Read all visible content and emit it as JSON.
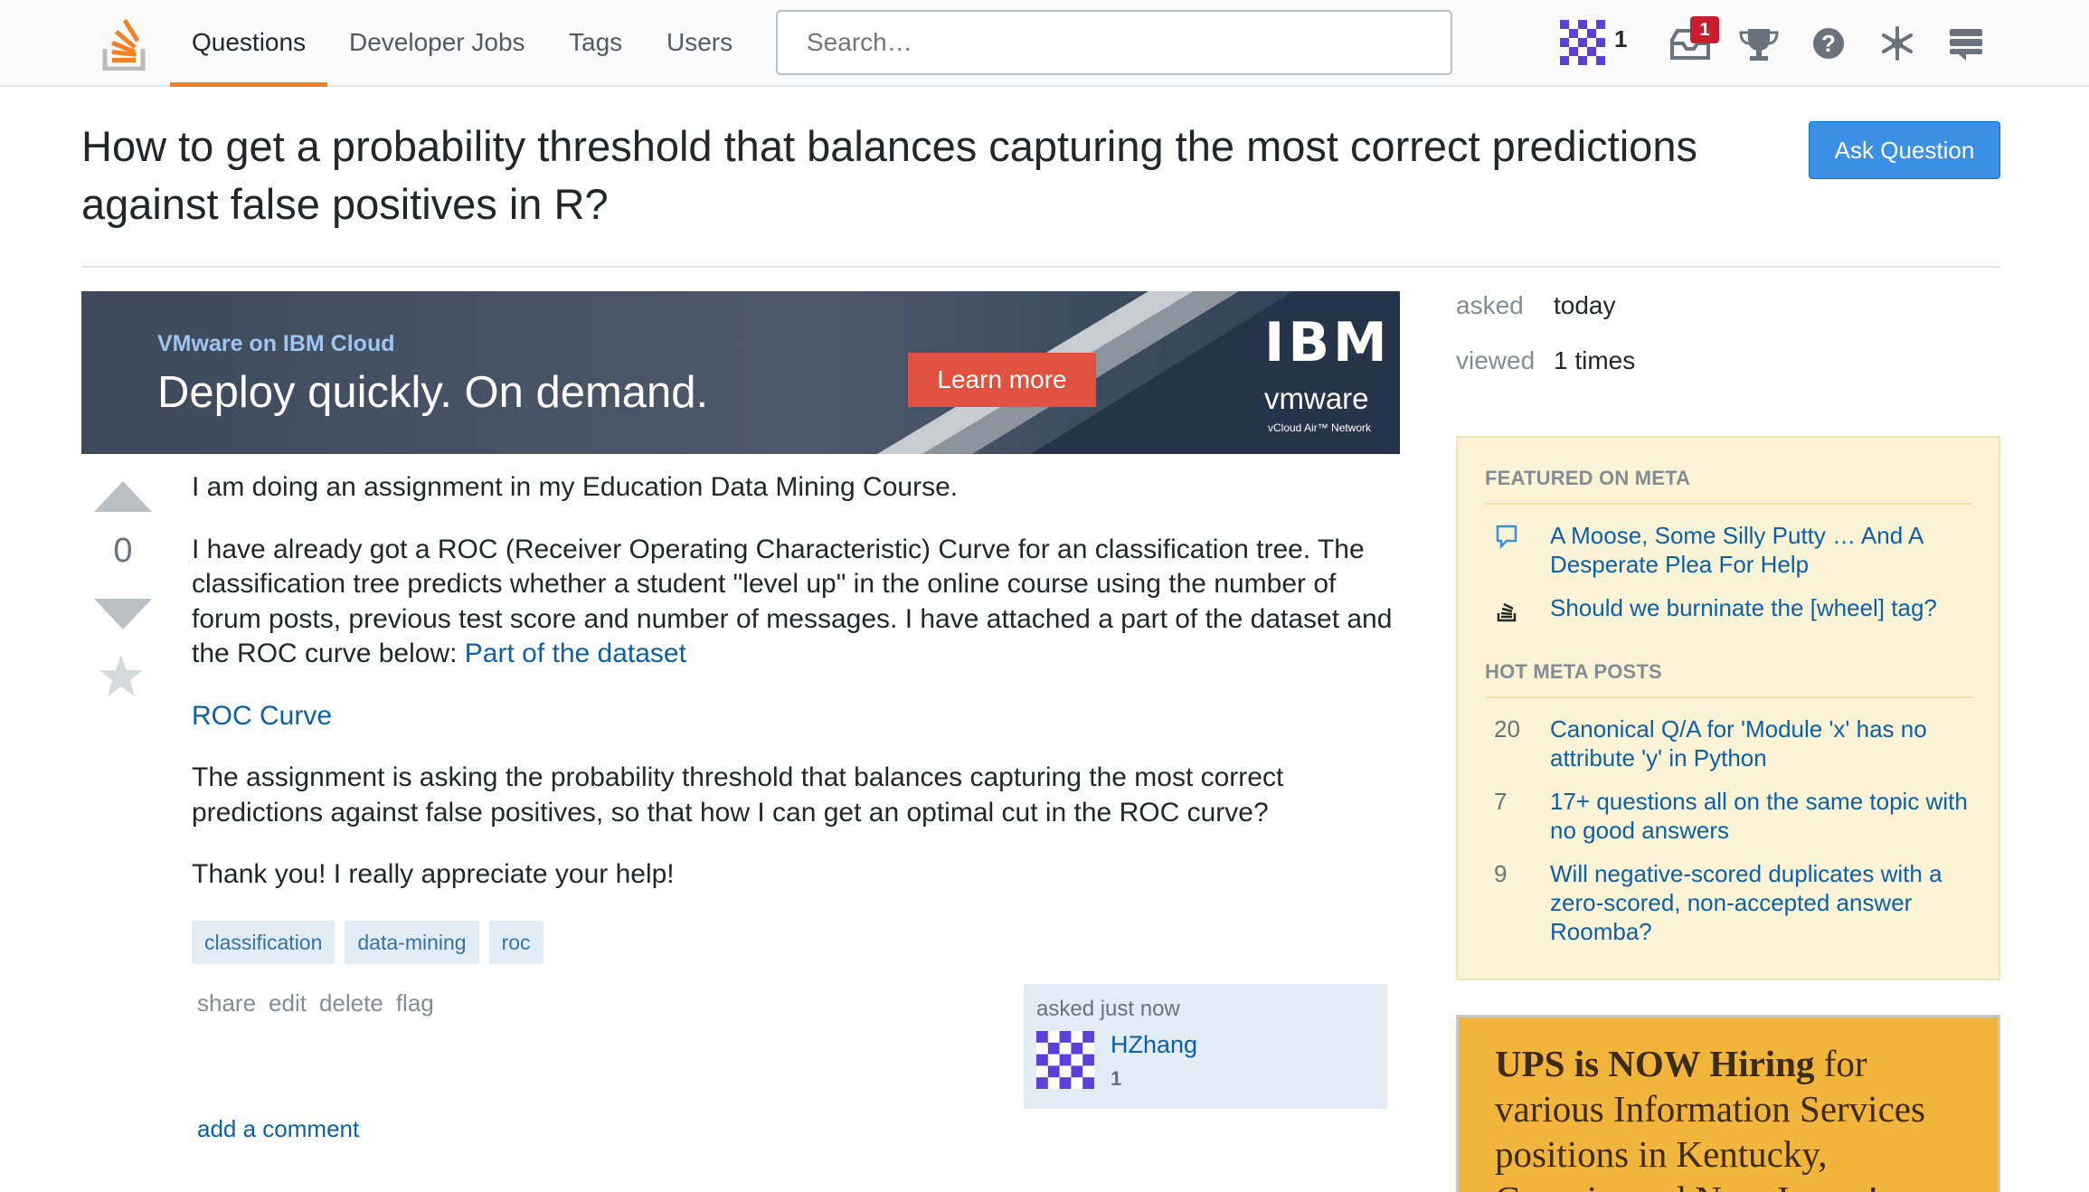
{
  "topbar": {
    "nav": [
      "Questions",
      "Developer Jobs",
      "Tags",
      "Users"
    ],
    "search_placeholder": "Search…",
    "reputation": "1",
    "inbox_count": "1"
  },
  "question": {
    "title": "How to get a probability threshold that balances capturing the most correct predictions against false positives in R?",
    "ask_button": "Ask Question",
    "votes": "0",
    "body": {
      "p1": "I am doing an assignment in my Education Data Mining Course.",
      "p2_text": "I have already got a ROC (Receiver Operating Characteristic) Curve for an classification tree. The classification tree predicts whether a student \"level up\" in the online course using the number of forum posts, previous test score and number of messages. I have attached a part of the dataset and the ROC curve below: ",
      "p2_link": "Part of the dataset",
      "roc_link": "ROC Curve",
      "p3": "The assignment is asking the probability threshold that balances capturing the most correct predictions against false positives, so that how I can get an optimal cut in the ROC curve?",
      "p4": "Thank you! I really appreciate your help!"
    },
    "tags": [
      "classification",
      "data-mining",
      "roc"
    ],
    "menu": [
      "share",
      "edit",
      "delete",
      "flag"
    ],
    "owner": {
      "asked": "asked just now",
      "name": "HZhang",
      "rep": "1"
    },
    "add_comment": "add a comment"
  },
  "ad_banner": {
    "subtitle": "VMware on IBM Cloud",
    "headline": "Deploy quickly. On demand.",
    "cta": "Learn more",
    "brand1": "IBM",
    "brand2": "vmware",
    "brand2_sub": "vCloud Air™ Network"
  },
  "sidebar": {
    "stats": [
      {
        "label": "asked",
        "value": "today"
      },
      {
        "label": "viewed",
        "value": "1 times"
      }
    ],
    "featured_heading": "FEATURED ON META",
    "featured": [
      {
        "text": "A Moose, Some Silly Putty … And A Desperate Plea For Help",
        "icon": "speech-bubble-icon"
      },
      {
        "text": "Should we burninate the [wheel] tag?",
        "icon": "stack-logo-icon"
      }
    ],
    "hot_heading": "HOT META POSTS",
    "hot": [
      {
        "score": "20",
        "text": "Canonical Q/A for 'Module 'x' has no attribute 'y' in Python"
      },
      {
        "score": "7",
        "text": "17+ questions all on the same topic with no good answers"
      },
      {
        "score": "9",
        "text": "Will negative-scored duplicates with a zero-scored, non-accepted answer Roomba?"
      }
    ]
  },
  "ups_ad": {
    "bold": "UPS is NOW Hiring",
    "rest": " for various Information Services positions in Kentucky, Georgia, and New Jersey!"
  },
  "colors": {
    "accent_orange": "#f48024",
    "link_blue": "#0c5fa8",
    "ask_button_blue": "#3b8fe5",
    "tag_bg": "#e1ecf4",
    "meta_box_bg": "#fbf3d5"
  }
}
